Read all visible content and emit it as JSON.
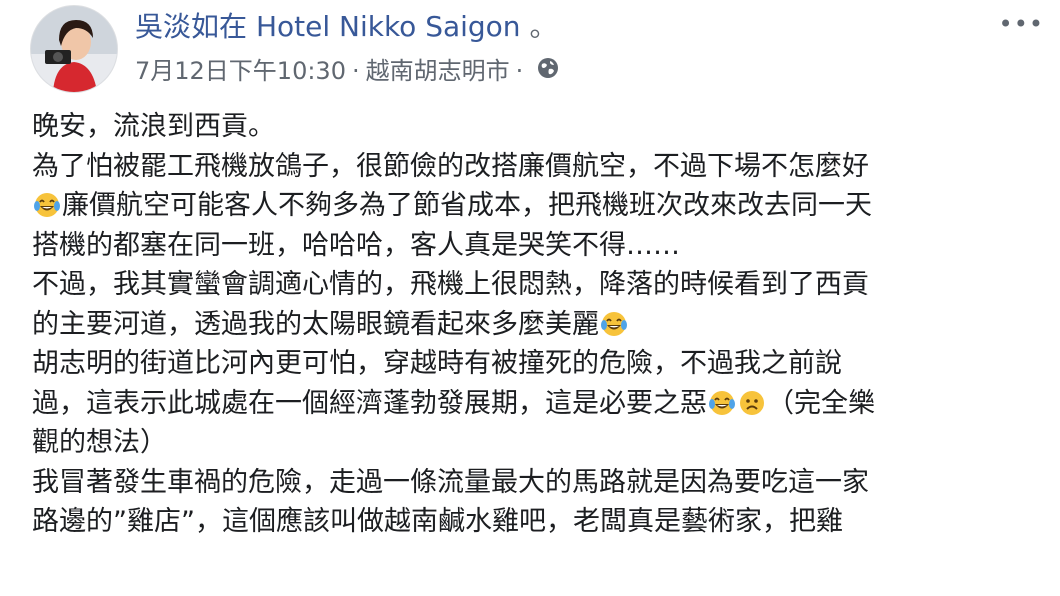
{
  "post": {
    "author": "吳淡如",
    "at_text": "在",
    "place": "Hotel Nikko Saigon",
    "period": "。",
    "timestamp": "7月12日下午10:30",
    "dot": "·",
    "location": "越南胡志明市",
    "dot2": "·",
    "privacy_icon": "globe-icon",
    "more_label": "•••"
  },
  "body": {
    "lines": [
      {
        "before": "晚安，流浪到西貢。",
        "emoji": null,
        "after": ""
      },
      {
        "before": "為了怕被罷工飛機放鴿子，很節儉的改搭廉價航空，不過下場不怎麼好",
        "emoji": null,
        "after": ""
      },
      {
        "before": "",
        "emoji": "tears-of-joy",
        "after": "廉價航空可能客人不夠多為了節省成本，把飛機班次改來改去同一天"
      },
      {
        "before": "搭機的都塞在同一班，哈哈哈，客人真是哭笑不得……",
        "emoji": null,
        "after": ""
      },
      {
        "before": "不過，我其實蠻會調適心情的，飛機上很悶熱，降落的時候看到了西貢",
        "emoji": null,
        "after": ""
      },
      {
        "before": "的主要河道，透過我的太陽眼鏡看起來多麼美麗",
        "emoji": "tears-of-joy",
        "after": ""
      },
      {
        "before": "胡志明的街道比河內更可怕，穿越時有被撞死的危險，不過我之前說",
        "emoji": null,
        "after": ""
      },
      {
        "before": "過，這表示此城處在一個經濟蓬勃發展期，這是必要之惡",
        "emoji": "tears-of-joy+frown",
        "after": "（完全樂"
      },
      {
        "before": "觀的想法）",
        "emoji": null,
        "after": ""
      },
      {
        "before": "我冒著發生車禍的危險，走過一條流量最大的馬路就是因為要吃這一家",
        "emoji": null,
        "after": ""
      },
      {
        "before": "路邊的”雞店”，這個應該叫做越南鹹水雞吧，老闆真是藝術家，把雞",
        "emoji": null,
        "after": ""
      }
    ]
  }
}
